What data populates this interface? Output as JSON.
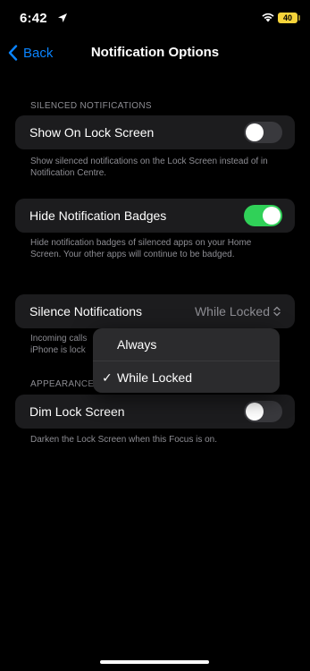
{
  "status_bar": {
    "time": "6:42",
    "battery": "40"
  },
  "nav": {
    "back_label": "Back",
    "title": "Notification Options"
  },
  "sections": {
    "silenced": {
      "header": "SILENCED NOTIFICATIONS",
      "show_on_lock_screen": {
        "label": "Show On Lock Screen",
        "enabled": false
      },
      "footer": "Show silenced notifications on the Lock Screen instead of in Notification Centre."
    },
    "badges": {
      "label": "Hide Notification Badges",
      "enabled": true,
      "footer": "Hide notification badges of silenced apps on your Home Screen. Your other apps will continue to be badged."
    },
    "silence": {
      "label": "Silence Notifications",
      "value": "While Locked",
      "footer_line1": "Incoming calls",
      "footer_line2": "iPhone is lock"
    },
    "appearance": {
      "header": "APPEARANCE",
      "dim_lock_screen": {
        "label": "Dim Lock Screen",
        "enabled": false
      },
      "footer": "Darken the Lock Screen when this Focus is on."
    }
  },
  "menu": {
    "items": [
      {
        "label": "Always",
        "checked": false
      },
      {
        "label": "While Locked",
        "checked": true
      }
    ],
    "check_glyph": "✓"
  },
  "colors": {
    "accent": "#0a84ff",
    "toggle_on": "#30d158",
    "battery": "#f7d43a"
  }
}
